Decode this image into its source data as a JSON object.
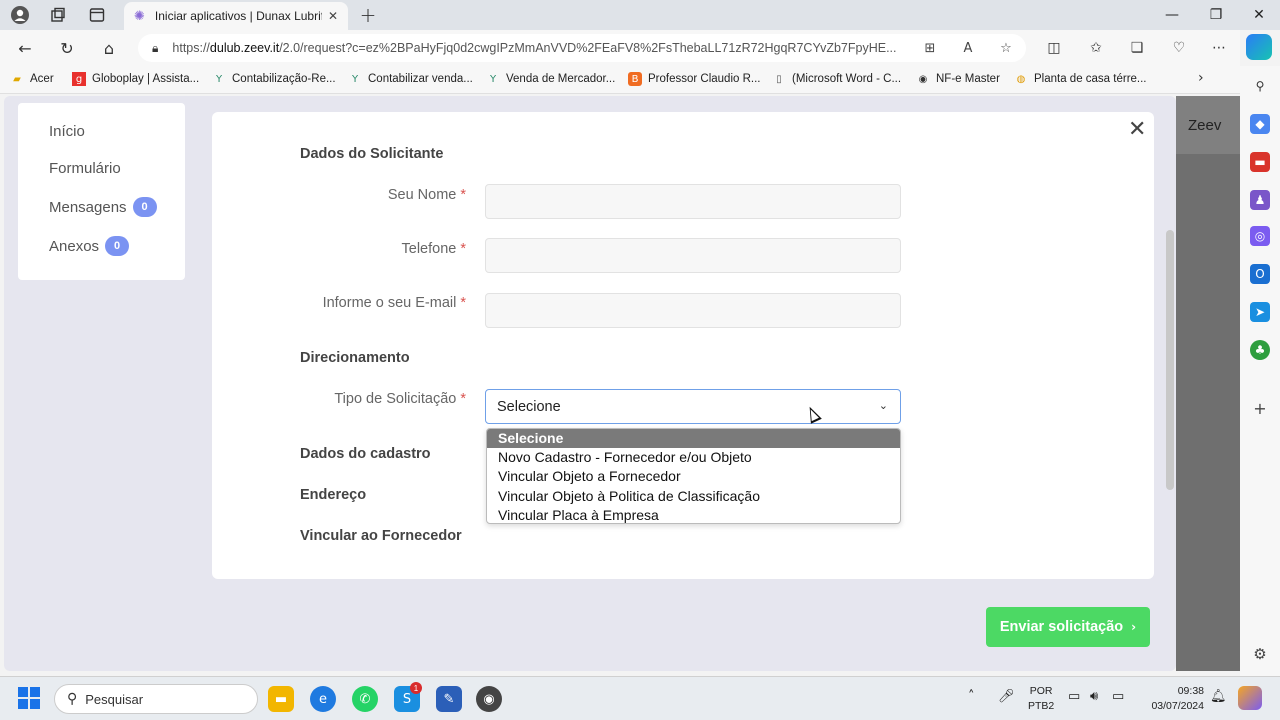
{
  "browser": {
    "tab_title": "Iniciar aplicativos | Dunax Lubrific",
    "url_prefix": "https://",
    "url_domain": "dulub.zeev.it",
    "url_path": "/2.0/request?c=ez%2BPaHyFjq0d2cwgIPzMmAnVVD%2FEaFV8%2FsThebaLL71zR72HgqR7CYvZb7FpyHE...",
    "bookmarks": [
      "Acer",
      "Globoplay | Assista...",
      "Contabilização-Re...",
      "Contabilizar venda...",
      "Venda de Mercador...",
      "Professor Claudio R...",
      "(Microsoft Word - C...",
      "NF-e Master",
      "Planta de casa térre..."
    ]
  },
  "side_menu": {
    "items": [
      {
        "label": "Início"
      },
      {
        "label": "Formulário"
      },
      {
        "label": "Mensagens",
        "badge": "0"
      },
      {
        "label": "Anexos",
        "badge": "0"
      }
    ]
  },
  "header_right": "Zeev",
  "form": {
    "sections": {
      "solicitante": "Dados do Solicitante",
      "direcionamento": "Direcionamento",
      "cadastro": "Dados do cadastro",
      "endereco": "Endereço",
      "fornecedor": "Vincular ao Fornecedor"
    },
    "fields": {
      "nome": "Seu Nome",
      "telefone": "Telefone",
      "email": "Informe o seu E-mail",
      "tipo": "Tipo de Solicitação"
    },
    "required_mark": "*",
    "select_value": "Selecione",
    "options": [
      "Selecione",
      "Novo Cadastro - Fornecedor e/ou Objeto",
      "Vincular Objeto a Fornecedor",
      "Vincular Objeto à Politica de Classificação",
      "Vincular Placa à Empresa"
    ],
    "submit_label": "Enviar solicitação"
  },
  "taskbar": {
    "search_label": "Pesquisar",
    "lang_line1": "POR",
    "lang_line2": "PTB2",
    "time": "09:38",
    "date": "03/07/2024",
    "skype_badge": "1"
  },
  "colors": {
    "submit": "#4cd964",
    "badge": "#7b93f2",
    "required": "#d9534f",
    "select_border": "#6fa0e8"
  }
}
